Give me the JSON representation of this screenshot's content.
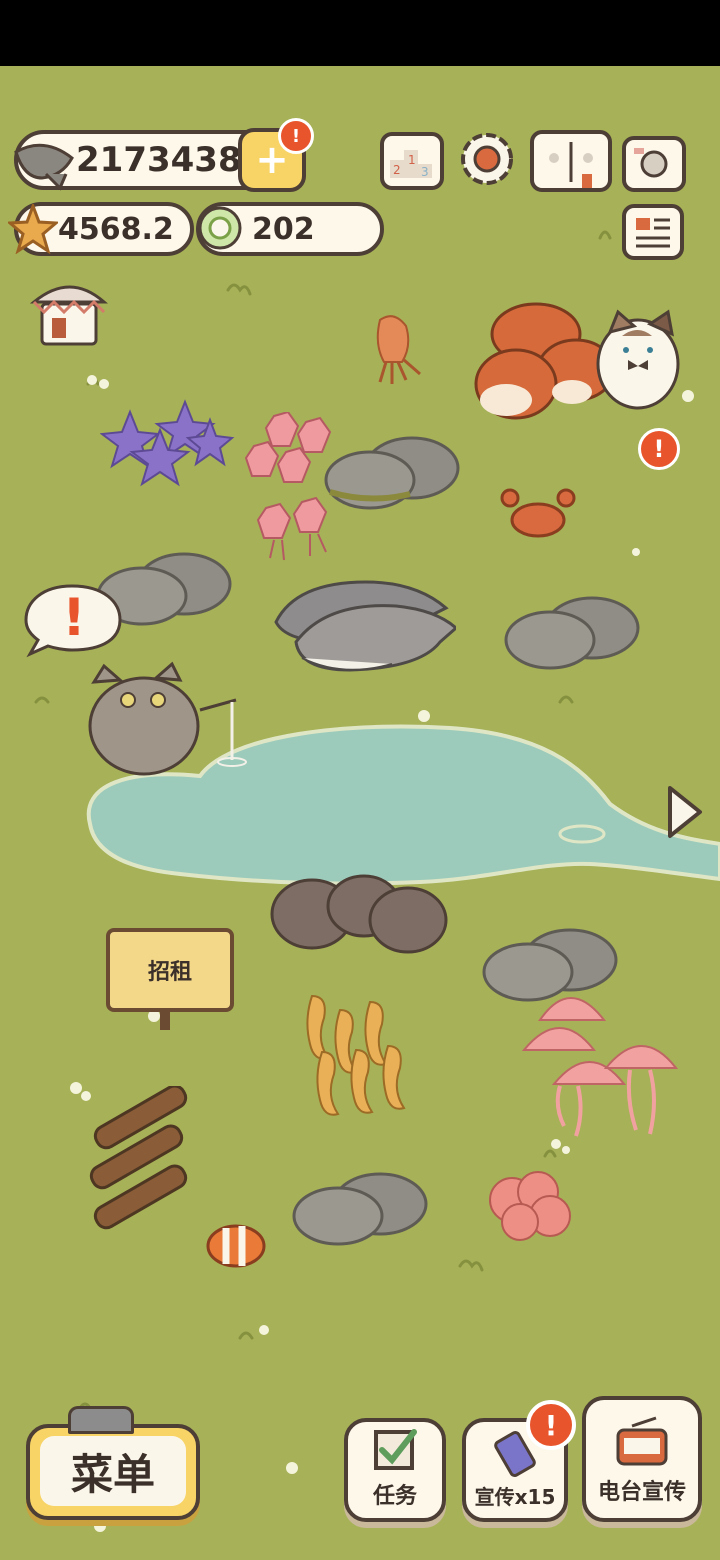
{
  "currency": {
    "fish": "2173438",
    "stars": "4568.2",
    "shells": "202"
  },
  "sign": {
    "label": "招租"
  },
  "bottom_bar": {
    "menu": "菜单",
    "tasks": "任务",
    "promote": "宣传x15",
    "radio": "电台宣传"
  },
  "alerts": {
    "mark": "!"
  },
  "colors": {
    "grass": "#a7b157",
    "water": "#9ccbbb",
    "outline": "#4d3e36",
    "alert": "#e8552c",
    "menu_yellow": "#f7d465"
  }
}
